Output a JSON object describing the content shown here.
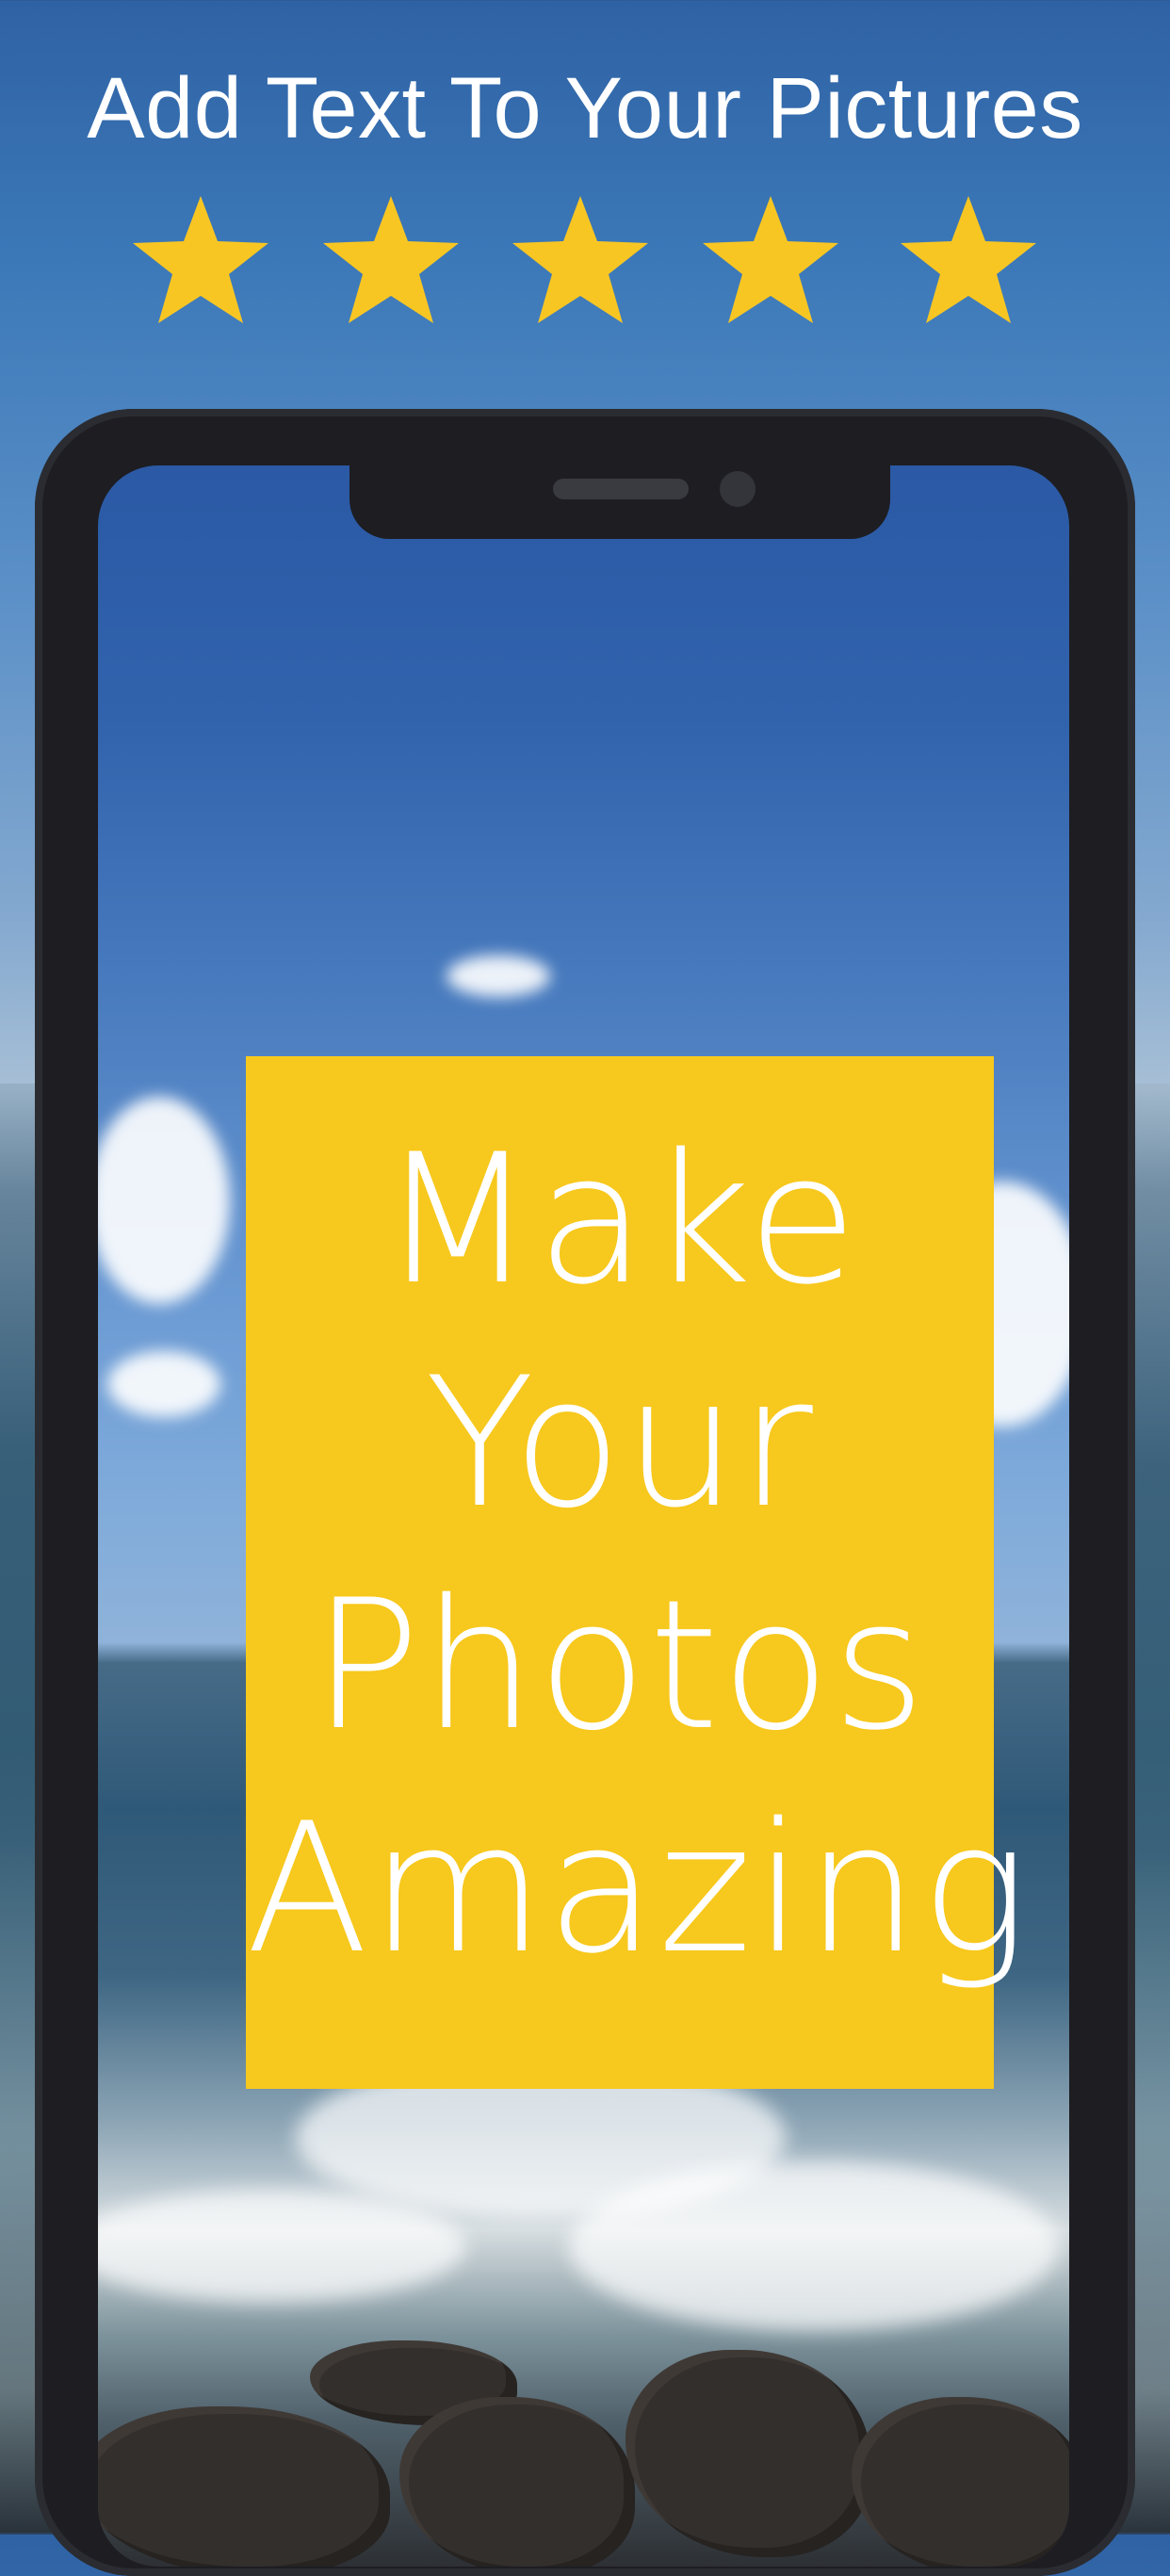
{
  "header": {
    "headline": "Add Text To Your Pictures"
  },
  "rating": {
    "stars": [
      {
        "icon": "star-icon"
      },
      {
        "icon": "star-icon"
      },
      {
        "icon": "star-icon"
      },
      {
        "icon": "star-icon"
      },
      {
        "icon": "star-icon"
      }
    ],
    "color": "#f8c623"
  },
  "preview": {
    "text_lines": [
      "Make",
      "Your",
      "Photos",
      "Amazing"
    ],
    "card_color": "#f7c81d",
    "text_color": "#ffffff"
  }
}
